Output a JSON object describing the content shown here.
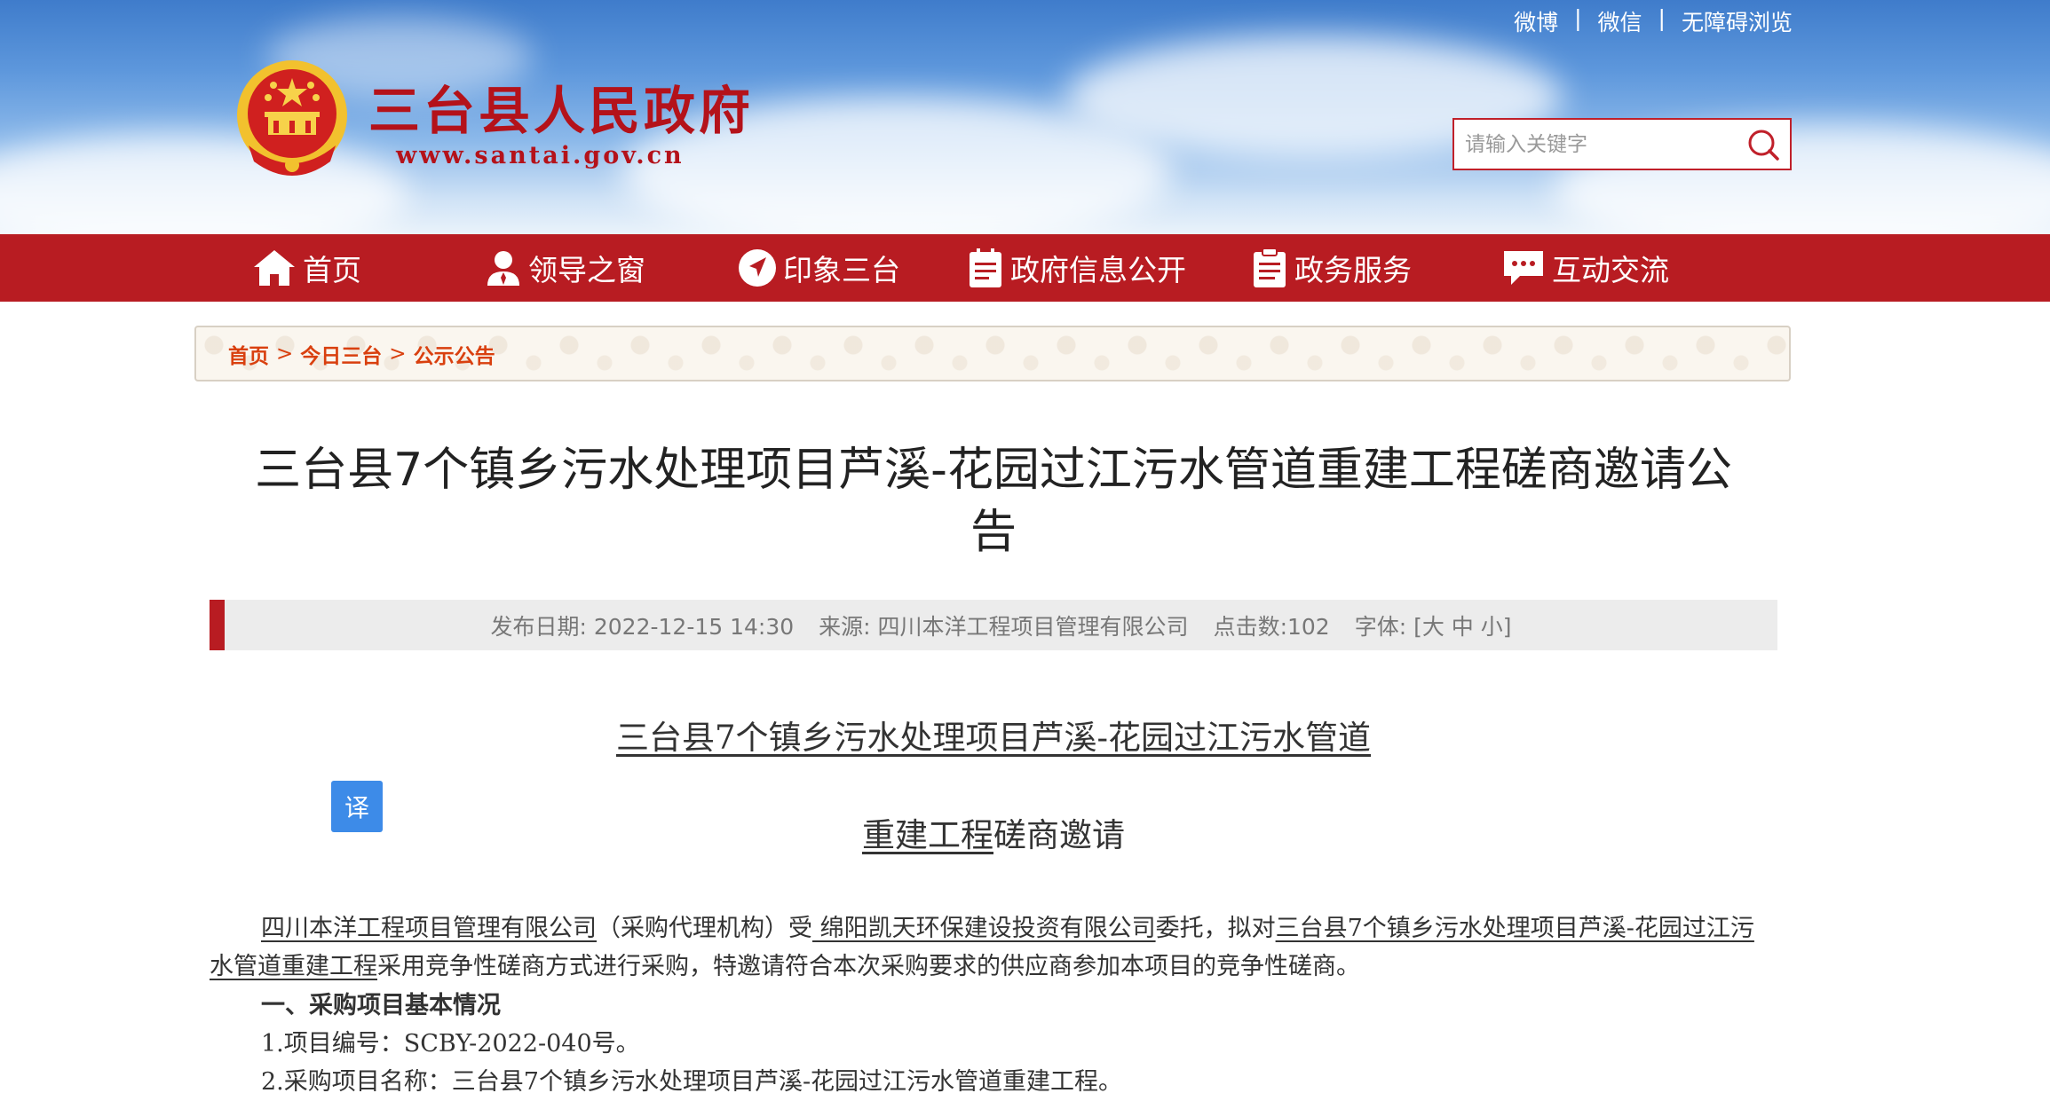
{
  "header": {
    "top_links": [
      "微博",
      "微信",
      "无障碍浏览"
    ],
    "site_title": "三台县人民政府",
    "site_url": "www.santai.gov.cn",
    "search_placeholder": "请输入关键字"
  },
  "nav": {
    "items": [
      {
        "label": "首页",
        "icon": "home-icon"
      },
      {
        "label": "领导之窗",
        "icon": "person-icon"
      },
      {
        "label": "印象三台",
        "icon": "navigate-icon"
      },
      {
        "label": "政府信息公开",
        "icon": "document-icon"
      },
      {
        "label": "政务服务",
        "icon": "clipboard-icon"
      },
      {
        "label": "互动交流",
        "icon": "chat-icon"
      }
    ]
  },
  "breadcrumb": {
    "items": [
      "首页",
      "今日三台",
      "公示公告"
    ],
    "separator": ">"
  },
  "article": {
    "title_line1": "三台县7个镇乡污水处理项目芦溪-花园过江污水管道重建工程磋商邀请公",
    "title_line2": "告",
    "meta": {
      "date_label": "发布日期:",
      "date": "2022-12-15 14:30",
      "source_label": "来源:",
      "source": "四川本洋工程项目管理有限公司",
      "clicks_label": "点击数:",
      "clicks": "102",
      "font_label": "字体:",
      "font_options": "[大 中 小]"
    },
    "translate_label": "译",
    "doc_title_line1": "三台县7个镇乡污水处理项目芦溪-花园过江污水管道",
    "doc_title_line2_underlined": "重建工程",
    "doc_title_line2_rest": "磋商邀请",
    "intro": {
      "agency": "四川本洋工程项目管理有限公司",
      "agency_role": "（采购代理机构）受",
      "client": "   绵阳凯天环保建设投资有限公司",
      "entrust": "委托，拟对",
      "project": "三台县7个镇乡污水处理项目芦溪-花园过江污水管道重建工程",
      "rest": "采用竞争性磋商方式进行采购，特邀请符合本次采购要求的供应商参加本项目的竞争性磋商。"
    },
    "section1_heading": "一、采购项目基本情况",
    "item1": "1.项目编号：SCBY-2022-040号。",
    "item2": "2.采购项目名称：三台县7个镇乡污水处理项目芦溪-花园过江污水管道重建工程。"
  },
  "colors": {
    "brand_red": "#b81c22",
    "breadcrumb_orange": "#d9400f",
    "translate_blue": "#3d8be8"
  }
}
